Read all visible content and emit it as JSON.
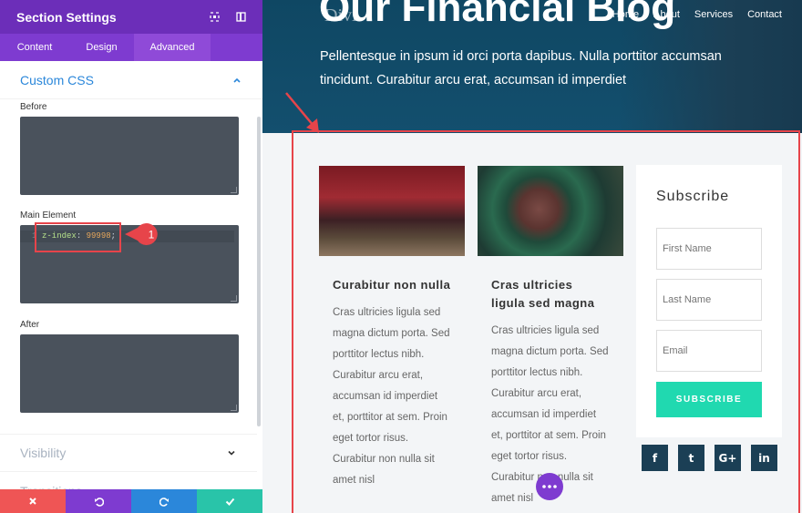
{
  "panel": {
    "title": "Section Settings",
    "tabs": [
      "Content",
      "Design",
      "Advanced"
    ],
    "active_tab": "Advanced",
    "custom_css": {
      "title": "Custom CSS",
      "before_label": "Before",
      "main_label": "Main Element",
      "main_code_property": "z-index",
      "main_code_value": "99998",
      "after_label": "After"
    },
    "visibility_title": "Visibility",
    "next_section_title": "Transitions",
    "callout_number": "1",
    "actions": [
      "cancel",
      "undo",
      "redo",
      "save"
    ]
  },
  "preview": {
    "nav": [
      "Home",
      "About",
      "Services",
      "Contact"
    ],
    "hero_title": "Our Financial Blog",
    "hero_subtitle": "Pellentesque in ipsum id orci porta dapibus. Nulla porttitor accumsan tincidunt. Curabitur arcu erat, accumsan id imperdiet",
    "posts": [
      {
        "title": "Curabitur non nulla",
        "excerpt": "Cras ultricies ligula sed magna dictum porta. Sed porttitor lectus nibh. Curabitur arcu erat, accumsan id imperdiet et, porttitor at sem. Proin eget tortor risus. Curabitur non nulla sit amet nisl"
      },
      {
        "title": "Cras ultricies ligula sed magna",
        "excerpt": "Cras ultricies ligula sed magna dictum porta. Sed porttitor lectus nibh. Curabitur arcu erat, accumsan id imperdiet et, porttitor at sem. Proin eget tortor risus. Curabitur non nulla sit amet nisl"
      }
    ],
    "subscribe": {
      "title": "Subscribe",
      "first_name_placeholder": "First Name",
      "last_name_placeholder": "Last Name",
      "email_placeholder": "Email",
      "button": "SUBSCRIBE"
    },
    "social": [
      "f",
      "t",
      "G+",
      "in"
    ]
  },
  "colors": {
    "purple": "#7e3bd0",
    "blue": "#2b87da",
    "teal": "#20d9b0",
    "red": "#e7444a",
    "hero": "#134f6e"
  }
}
